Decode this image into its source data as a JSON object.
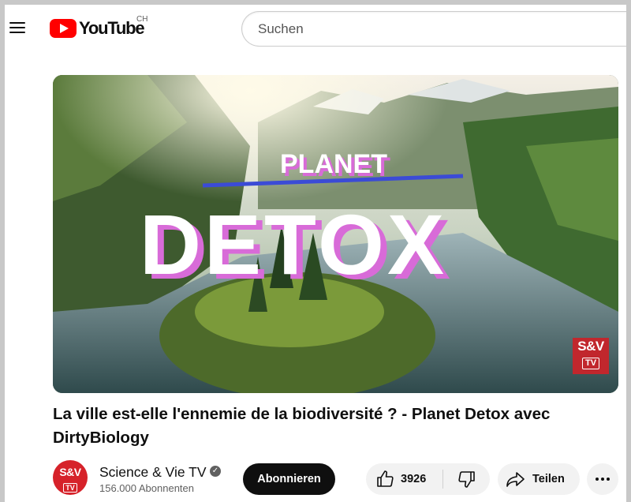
{
  "header": {
    "logo_text": "YouTube",
    "region": "CH",
    "search_placeholder": "Suchen"
  },
  "video": {
    "overlay_title_top": "PLANET",
    "overlay_title_main": "DETOX",
    "badge_line1": "S&V",
    "badge_line2": "TV",
    "title": "La ville est-elle l'ennemie de la biodiversité ? - Planet Detox avec DirtyBiology"
  },
  "channel": {
    "avatar_line1": "S&V",
    "avatar_line2": "TV",
    "name": "Science & Vie TV",
    "verified_icon": "check-icon",
    "subscribers": "156.000 Abonnenten",
    "subscribe_label": "Abonnieren"
  },
  "actions": {
    "like_count": "3926",
    "share_label": "Teilen",
    "icons": [
      "like-icon",
      "dislike-icon",
      "share-icon",
      "more-icon"
    ]
  },
  "colors": {
    "brand_red": "#ff0000",
    "subscribe_bg": "#0f0f0f",
    "badge_red": "#c1272d",
    "title_accent": "#d86bd8"
  }
}
